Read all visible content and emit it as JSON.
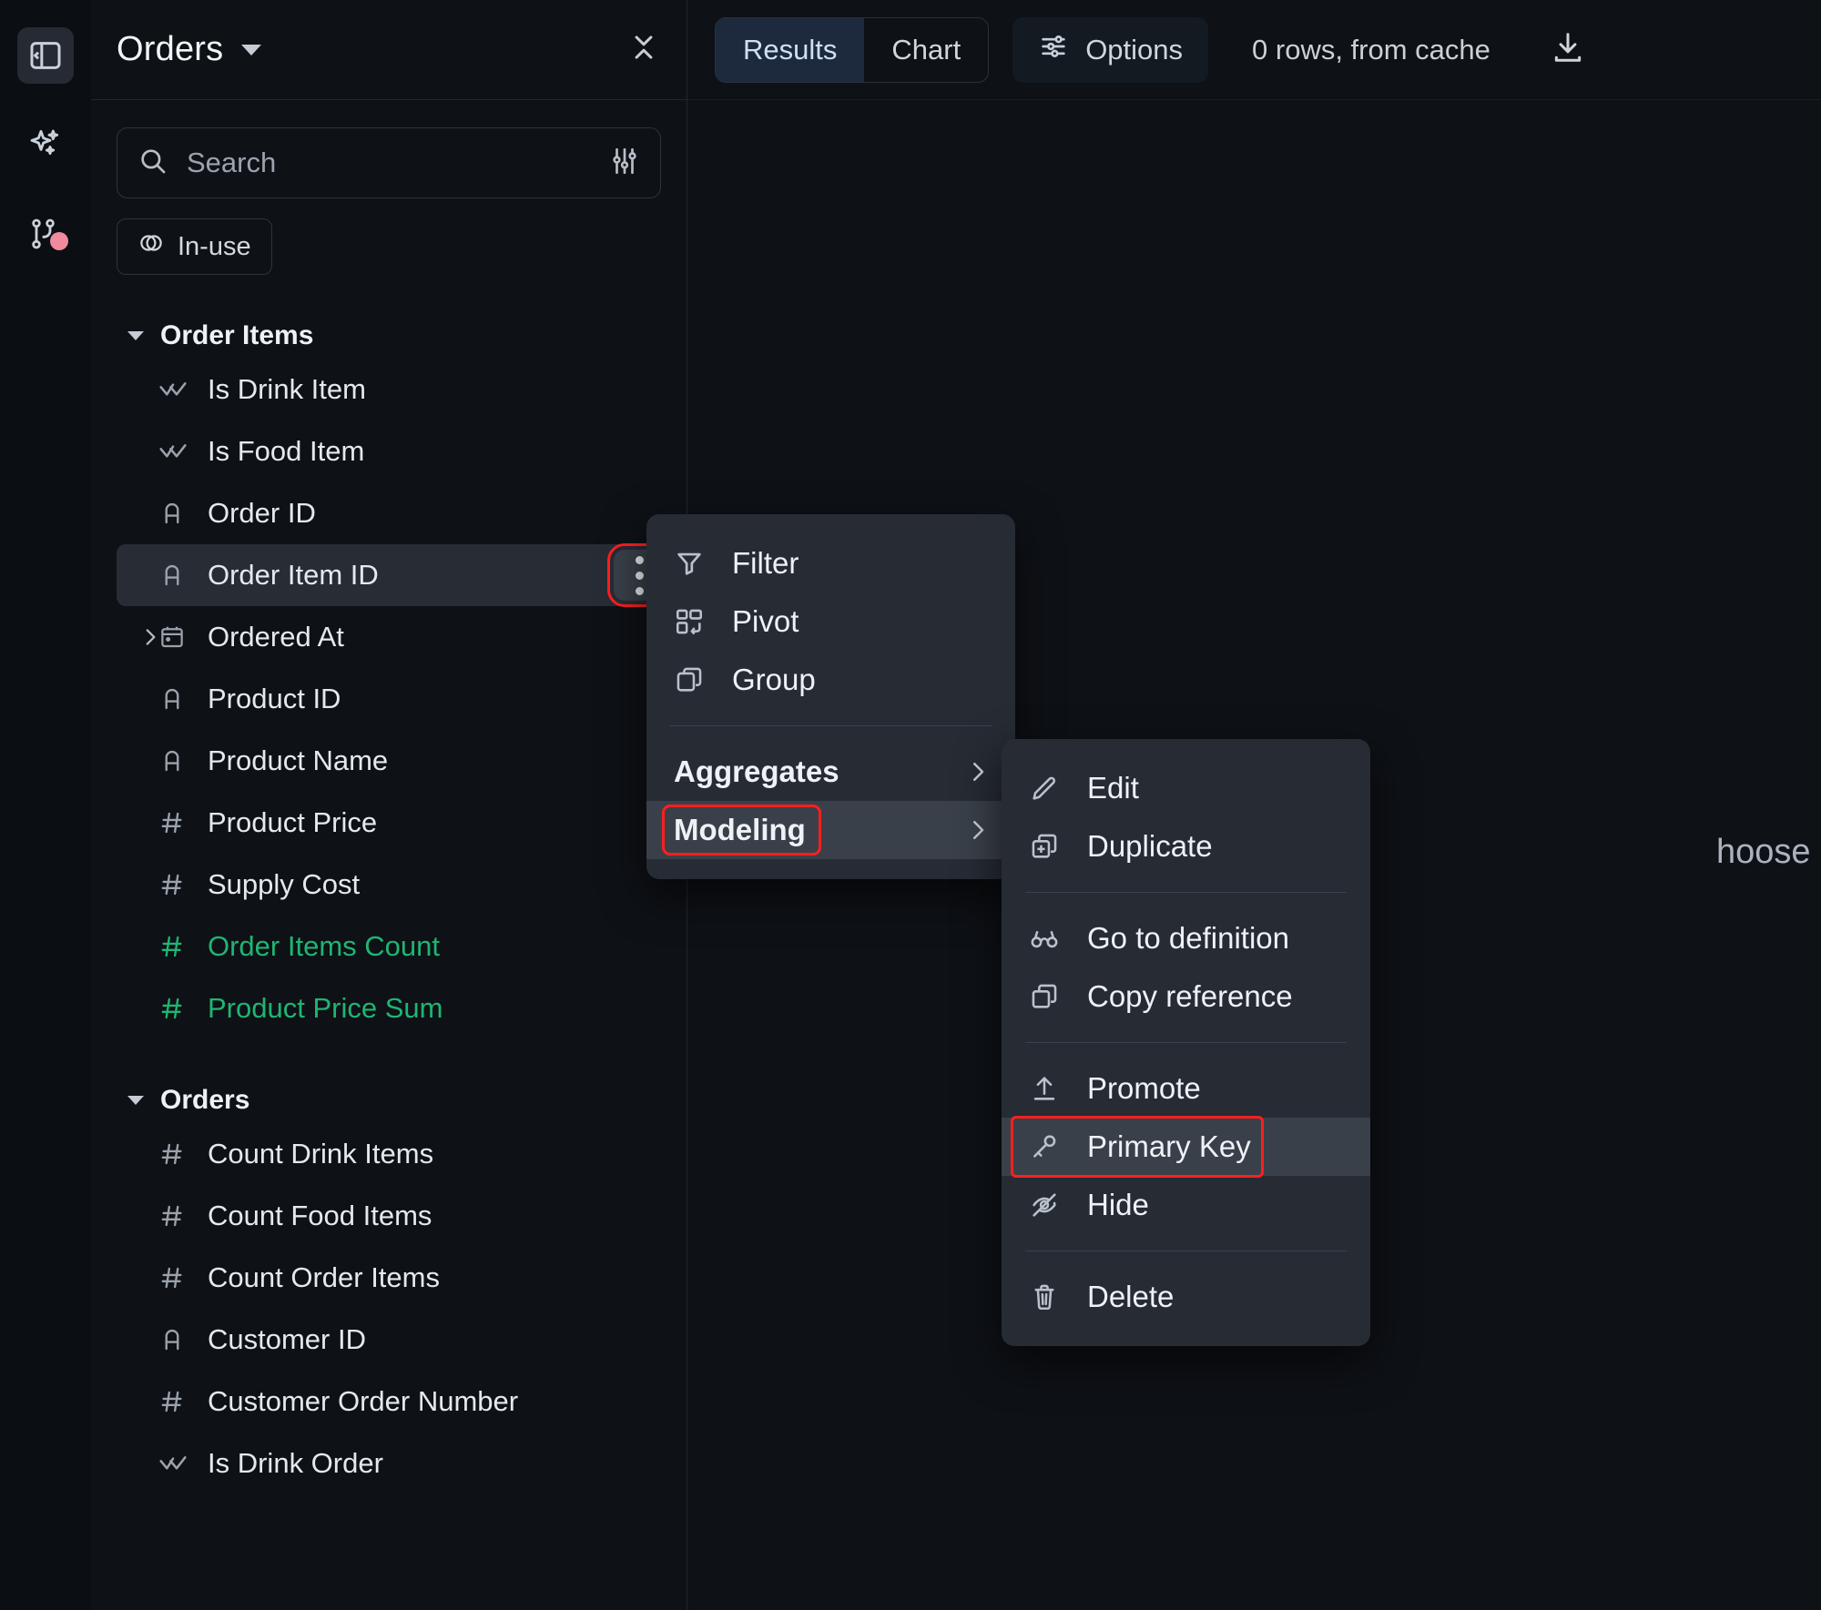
{
  "rail": {
    "items": [
      {
        "name": "collapse-panel",
        "icon": "panel-collapse-icon",
        "active": true
      },
      {
        "name": "assistant",
        "icon": "sparkle-icon",
        "active": false
      },
      {
        "name": "version-control",
        "icon": "branch-icon",
        "active": false,
        "badge": true
      }
    ]
  },
  "sidebar": {
    "title": "Orders",
    "collapse_icon": "collapse-chevrons-icon",
    "search": {
      "placeholder": "Search",
      "value": "",
      "icon": "search-icon",
      "filter_icon": "sliders-icon"
    },
    "chip": {
      "label": "In-use",
      "icon": "in-use-icon"
    },
    "groups": [
      {
        "name": "Order Items",
        "expanded": true,
        "fields": [
          {
            "label": "Is Drink Item",
            "type": "boolean",
            "icon": "double-check-icon",
            "measure": false,
            "selected": false,
            "expandable": false
          },
          {
            "label": "Is Food Item",
            "type": "boolean",
            "icon": "double-check-icon",
            "measure": false,
            "selected": false,
            "expandable": false
          },
          {
            "label": "Order ID",
            "type": "string",
            "icon": "letter-a-icon",
            "measure": false,
            "selected": false,
            "expandable": false
          },
          {
            "label": "Order Item ID",
            "type": "string",
            "icon": "letter-a-icon",
            "measure": false,
            "selected": true,
            "expandable": false
          },
          {
            "label": "Ordered At",
            "type": "date",
            "icon": "calendar-icon",
            "measure": false,
            "selected": false,
            "expandable": true
          },
          {
            "label": "Product ID",
            "type": "string",
            "icon": "letter-a-icon",
            "measure": false,
            "selected": false,
            "expandable": false
          },
          {
            "label": "Product Name",
            "type": "string",
            "icon": "letter-a-icon",
            "measure": false,
            "selected": false,
            "expandable": false
          },
          {
            "label": "Product Price",
            "type": "number",
            "icon": "hash-icon",
            "measure": false,
            "selected": false,
            "expandable": false
          },
          {
            "label": "Supply Cost",
            "type": "number",
            "icon": "hash-icon",
            "measure": false,
            "selected": false,
            "expandable": false
          },
          {
            "label": "Order Items Count",
            "type": "number",
            "icon": "hash-icon",
            "measure": true,
            "selected": false,
            "expandable": false
          },
          {
            "label": "Product Price Sum",
            "type": "number",
            "icon": "hash-icon",
            "measure": true,
            "selected": false,
            "expandable": false
          }
        ]
      },
      {
        "name": "Orders",
        "expanded": true,
        "fields": [
          {
            "label": "Count Drink Items",
            "type": "number",
            "icon": "hash-icon",
            "measure": false,
            "selected": false,
            "expandable": false
          },
          {
            "label": "Count Food Items",
            "type": "number",
            "icon": "hash-icon",
            "measure": false,
            "selected": false,
            "expandable": false
          },
          {
            "label": "Count Order Items",
            "type": "number",
            "icon": "hash-icon",
            "measure": false,
            "selected": false,
            "expandable": false
          },
          {
            "label": "Customer ID",
            "type": "string",
            "icon": "letter-a-icon",
            "measure": false,
            "selected": false,
            "expandable": false
          },
          {
            "label": "Customer Order Number",
            "type": "number",
            "icon": "hash-icon",
            "measure": false,
            "selected": false,
            "expandable": false
          },
          {
            "label": "Is Drink Order",
            "type": "boolean",
            "icon": "double-check-icon",
            "measure": false,
            "selected": false,
            "expandable": false
          }
        ]
      }
    ]
  },
  "toolbar": {
    "tabs": [
      {
        "label": "Results",
        "active": true
      },
      {
        "label": "Chart",
        "active": false
      }
    ],
    "options_label": "Options",
    "options_icon": "sliders-icon",
    "rows_status": "0 rows, from cache",
    "download_icon": "download-icon"
  },
  "main": {
    "empty_message": "hoose some fields to get"
  },
  "context_menu": {
    "items": [
      {
        "label": "Filter",
        "icon": "funnel-icon",
        "submenu": false,
        "highlighted": false,
        "bold": false
      },
      {
        "label": "Pivot",
        "icon": "pivot-icon",
        "submenu": false,
        "highlighted": false,
        "bold": false
      },
      {
        "label": "Group",
        "icon": "layers-icon",
        "submenu": false,
        "highlighted": false,
        "bold": false
      }
    ],
    "group_items": [
      {
        "label": "Aggregates",
        "icon": null,
        "submenu": true,
        "highlighted": false,
        "bold": true,
        "ringed": false
      },
      {
        "label": "Modeling",
        "icon": null,
        "submenu": true,
        "highlighted": true,
        "bold": true,
        "ringed": true
      }
    ]
  },
  "submenu": {
    "section1": [
      {
        "label": "Edit",
        "icon": "pencil-icon",
        "highlighted": false,
        "ringed": false
      },
      {
        "label": "Duplicate",
        "icon": "duplicate-icon",
        "highlighted": false,
        "ringed": false
      }
    ],
    "section2": [
      {
        "label": "Go to definition",
        "icon": "glasses-icon",
        "highlighted": false,
        "ringed": false
      },
      {
        "label": "Copy reference",
        "icon": "copy-icon",
        "highlighted": false,
        "ringed": false
      }
    ],
    "section3": [
      {
        "label": "Promote",
        "icon": "upload-icon",
        "highlighted": false,
        "ringed": false
      },
      {
        "label": "Primary Key",
        "icon": "key-icon",
        "highlighted": true,
        "ringed": true
      },
      {
        "label": "Hide",
        "icon": "eye-off-icon",
        "highlighted": false,
        "ringed": false
      }
    ],
    "section4": [
      {
        "label": "Delete",
        "icon": "trash-icon",
        "highlighted": false,
        "ringed": false
      }
    ]
  },
  "colors": {
    "accent_green": "#1fb573",
    "tab_active_bg": "#1d2a3d",
    "highlight_ring": "#ff1f1f",
    "menu_bg": "#262b34",
    "badge_pink": "#f08a9f"
  }
}
